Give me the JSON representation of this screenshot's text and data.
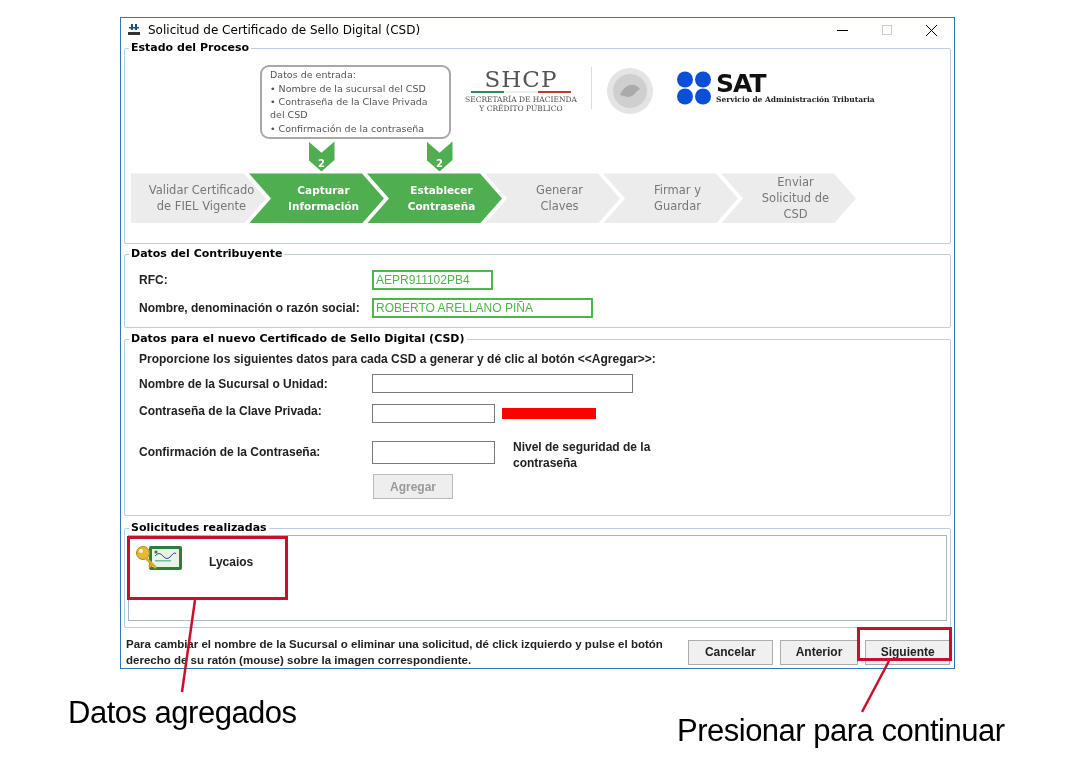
{
  "window": {
    "title": "Solicitud de Certificado de Sello Digital (CSD)"
  },
  "process": {
    "legend": "Estado del Proceso",
    "callout": {
      "title": "Datos de entrada:",
      "items": [
        "• Nombre de la sucursal del CSD",
        "• Contraseña de la Clave Privada del CSD",
        "• Confirmación de la contraseña"
      ]
    },
    "logos": {
      "shcp": "SHCP",
      "shcp_subtitle": "SECRETARÍA DE HACIENDA\nY CRÉDITO PÚBLICO",
      "sat": "SAT",
      "sat_subtitle": "Servicio de Administración Tributaria"
    },
    "steps": [
      {
        "label": "Validar Certificado\nde FIEL Vigente",
        "active": false
      },
      {
        "label": "Capturar\nInformación",
        "active": true,
        "badge": "2"
      },
      {
        "label": "Establecer\nContraseña",
        "active": true,
        "badge": "2"
      },
      {
        "label": "Generar\nClaves",
        "active": false
      },
      {
        "label": "Firmar y\nGuardar",
        "active": false
      },
      {
        "label": "Enviar\nSolicitud de\nCSD",
        "active": false
      }
    ]
  },
  "taxpayer": {
    "legend": "Datos del Contribuyente",
    "fields": [
      {
        "label": "RFC:",
        "value": "AEPR911102PB4"
      },
      {
        "label": "Nombre, denominación o razón social:",
        "value": "ROBERTO ARELLANO PIÑA"
      }
    ]
  },
  "new_csd": {
    "legend": "Datos para el nuevo Certificado de Sello Digital (CSD)",
    "instruction": "Proporcione los siguientes datos para cada CSD a generar y dé clic al botón <<Agregar>>:",
    "branch_label": "Nombre de la Sucursal o Unidad:",
    "password_label": "Contraseña de la Clave Privada:",
    "confirm_label": "Confirmación de la Contraseña:",
    "strength": {
      "level": 1,
      "caption": "Nivel de seguridad de la contraseña"
    },
    "add_button": {
      "label": "Agregar",
      "disabled": true
    }
  },
  "requests": {
    "legend": "Solicitudes realizadas",
    "items": [
      {
        "name": "Lycaios"
      }
    ]
  },
  "footer": {
    "note": "Para cambiar el nombre de la Sucursal o eliminar una solicitud, dé click izquierdo y pulse el botón derecho de su ratón (mouse) sobre la imagen correspondiente.",
    "buttons": [
      {
        "label": "Cancelar"
      },
      {
        "label": "Anterior"
      },
      {
        "label": "Siguiente"
      }
    ]
  },
  "annotations": [
    {
      "text": "Datos agregados"
    },
    {
      "text": "Presionar para continuar"
    }
  ]
}
